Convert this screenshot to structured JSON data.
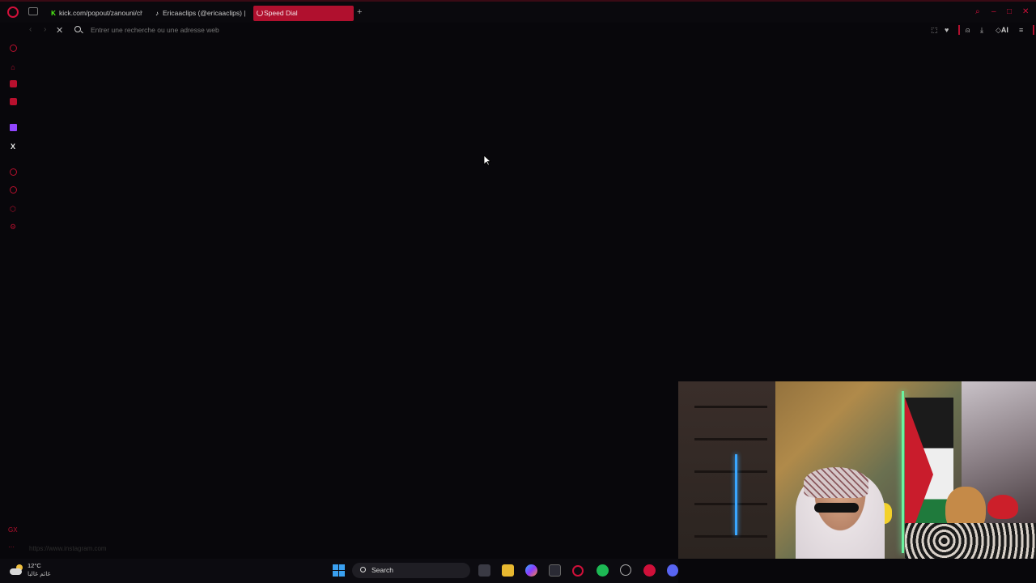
{
  "browser": {
    "tabs": [
      {
        "label": "kick.com/popout/zanouni/chat",
        "favicon": "K"
      },
      {
        "label": "Ericaaclips (@ericaaclips) | TikTok",
        "favicon": "♪"
      },
      {
        "label": "Speed Dial",
        "active": true
      }
    ],
    "new_tab_label": "+",
    "address_placeholder": "Entrer une recherche ou une adresse web",
    "ai_label": "AI",
    "status_url": "https://www.instagram.com"
  },
  "colors": {
    "accent": "#b0102e",
    "background": "#08070b"
  },
  "sidebar": {
    "items": [
      {
        "icon": "ring-icon"
      },
      {
        "icon": "bag-icon"
      },
      {
        "icon": "messenger-icon"
      },
      {
        "icon": "whatsapp-icon"
      },
      {
        "icon": "twitch-icon"
      },
      {
        "icon": "x-icon",
        "glyph": "X"
      },
      {
        "icon": "player-icon"
      },
      {
        "icon": "history-icon"
      },
      {
        "icon": "extensions-icon"
      },
      {
        "icon": "settings-icon"
      }
    ],
    "bottom_label": "GX"
  },
  "taskbar": {
    "temperature": "12°C",
    "condition": "غائم غالبا",
    "search_label": "Search"
  }
}
